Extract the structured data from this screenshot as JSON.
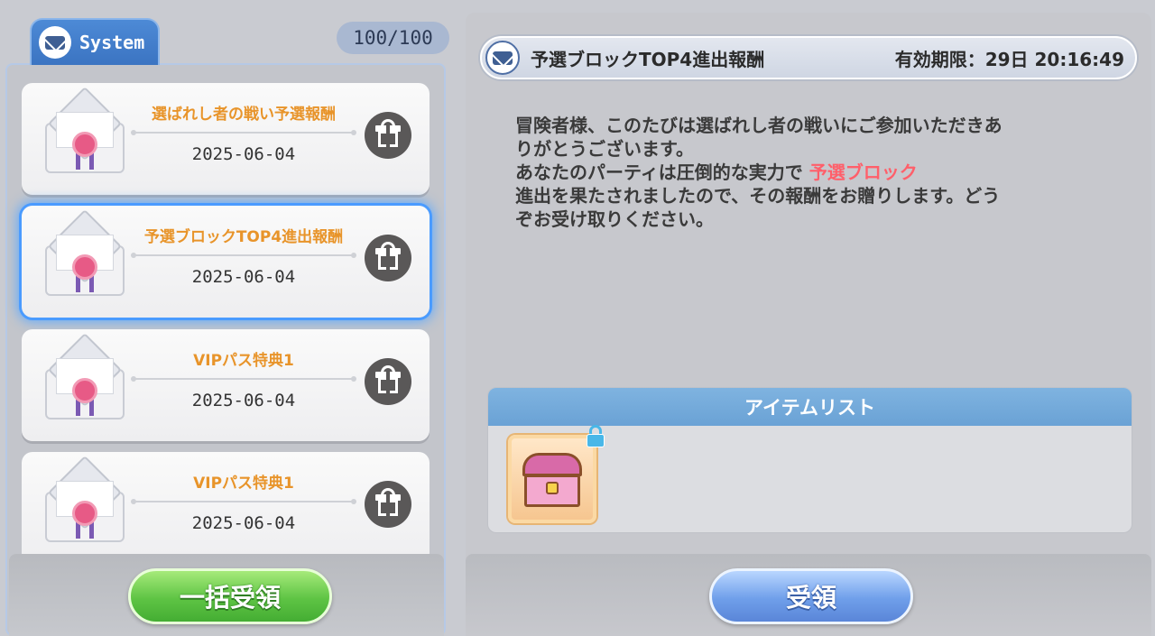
{
  "left": {
    "tab_label": "System",
    "count": "100/100",
    "mails": [
      {
        "title": "選ばれし者の戦い予選報酬",
        "date": "2025-06-04",
        "selected": false
      },
      {
        "title": "予選ブロックTOP4進出報酬",
        "date": "2025-06-04",
        "selected": true
      },
      {
        "title": "VIPパス特典1",
        "date": "2025-06-04",
        "selected": false
      },
      {
        "title": "VIPパス特典1",
        "date": "2025-06-04",
        "selected": false
      }
    ],
    "bulk_button": "一括受領"
  },
  "detail": {
    "title": "予選ブロックTOP4進出報酬",
    "expiry": "有効期限：29日 20:16:49",
    "message_line1": "冒険者様、このたびは選ばれし者の戦いにご参加いただきあ",
    "message_line2": "りがとうございます。",
    "message_line3_pre": "あなたのパーティは圧倒的な実力で",
    "message_highlight": "予選ブロック",
    "message_line4": "進出を果たされましたので、その報酬をお贈りします。どう",
    "message_line5": "ぞお受け取りください。",
    "items_header": "アイテムリスト",
    "items": [
      {
        "icon": "treasure-chest-icon",
        "locked": true
      }
    ],
    "receive_button": "受領"
  },
  "colors": {
    "mail_title": "#e8942a",
    "highlight": "#ff5f6a",
    "tab_blue": "#3b74c2",
    "green_button": "#5ec444",
    "blue_button": "#6f9fea"
  }
}
